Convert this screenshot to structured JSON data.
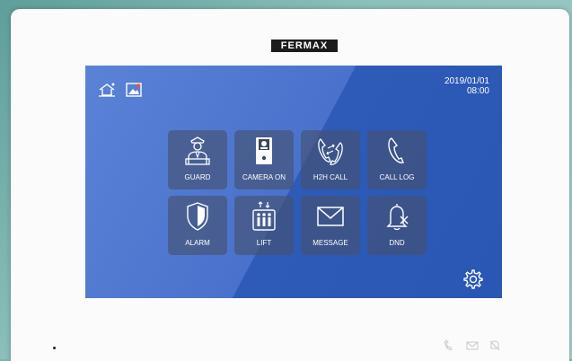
{
  "brand": {
    "logo": "FERMAX"
  },
  "screen": {
    "date": "2019/01/01",
    "time": "08:00",
    "tiles": [
      {
        "label": "GUARD",
        "icon": "guard-icon"
      },
      {
        "label": "CAMERA ON",
        "icon": "camera-panel-icon"
      },
      {
        "label": "H2H CALL",
        "icon": "h2h-call-icon"
      },
      {
        "label": "CALL LOG",
        "icon": "call-log-icon"
      },
      {
        "label": "ALARM",
        "icon": "shield-icon"
      },
      {
        "label": "LIFT",
        "icon": "lift-icon"
      },
      {
        "label": "MESSAGE",
        "icon": "envelope-icon"
      },
      {
        "label": "DND",
        "icon": "bell-muted-icon"
      }
    ]
  },
  "colors": {
    "screen_light": "#5a82d6",
    "screen_dark": "#2a56b4",
    "tile": "#46506e"
  }
}
